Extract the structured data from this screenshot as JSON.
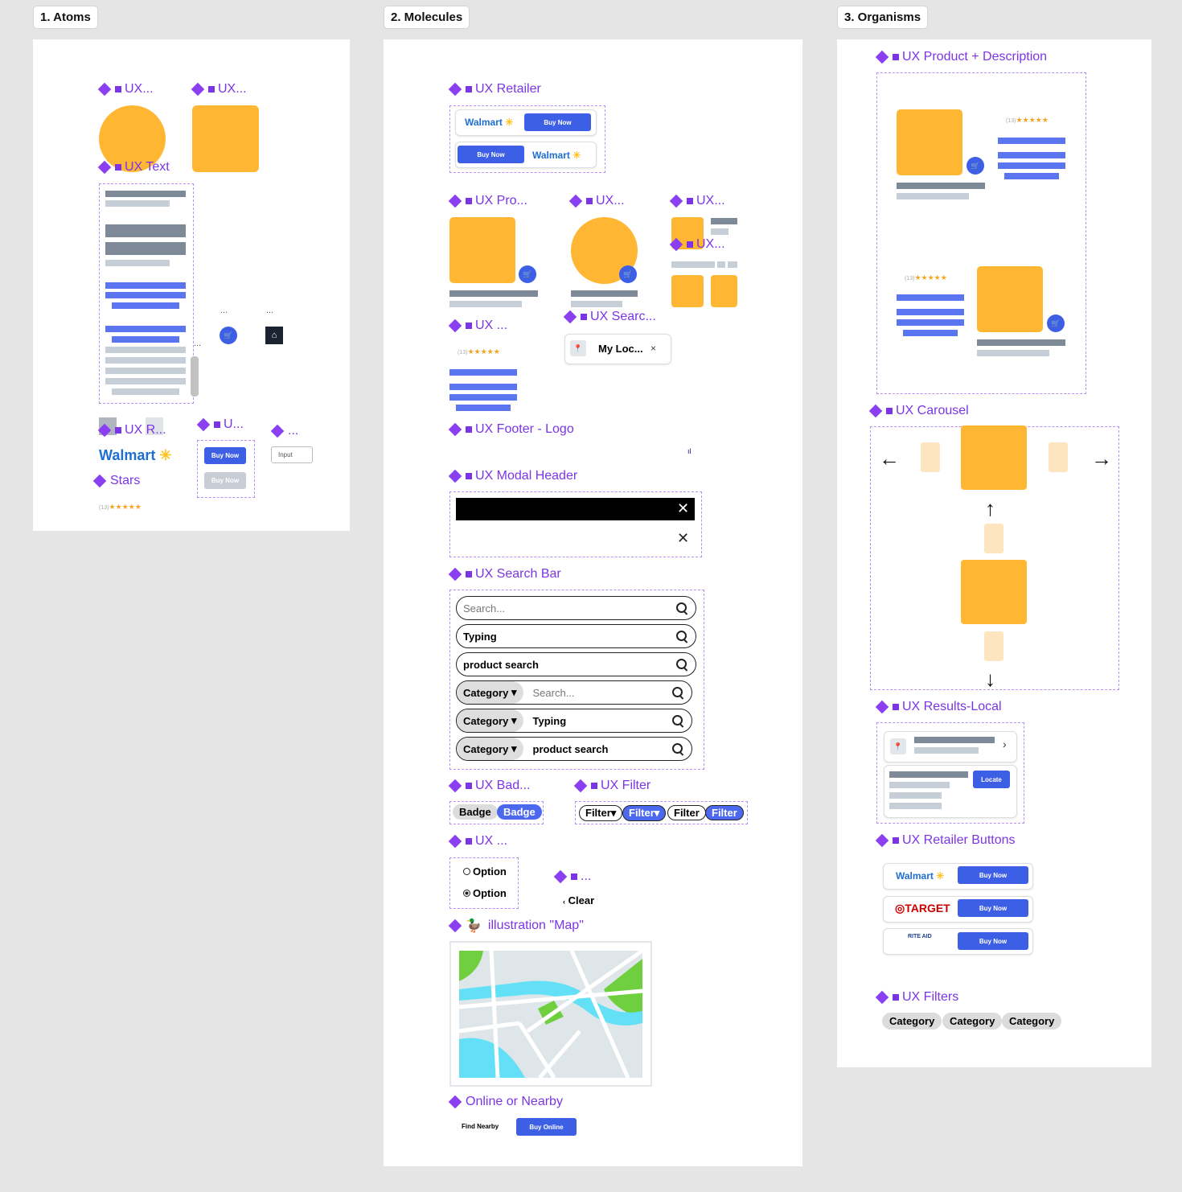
{
  "frames": {
    "atoms": "1. Atoms",
    "molecules": "2. Molecules",
    "organisms": "3. Organisms"
  },
  "atoms": {
    "comp_image_round": "UX...",
    "comp_image_square": "UX...",
    "comp_text": "UX Text",
    "comp_icons_label": "UX R...",
    "comp_buttons": "U...",
    "comp_input": "...",
    "comp_stars": "Stars",
    "ellipsis": "...",
    "walmart": "Walmart",
    "buy_now": "Buy Now",
    "buy_now_disabled": "Buy Now",
    "input_label": "Input",
    "star_count": "(13)",
    "stars": "★★★★★",
    "cart_icon": "cart-icon",
    "basket_icon": "basket-icon"
  },
  "molecules": {
    "comp_retailer": "UX Retailer",
    "walmart": "Walmart",
    "buy_now": "Buy Now",
    "comp_product": "UX Pro...",
    "comp_product_round": "UX...",
    "comp_product_small_a": "UX...",
    "comp_product_small_b": "UX...",
    "comp_rating": "UX ...",
    "star_count": "(13)",
    "stars": "★★★★★",
    "comp_search_chip": "UX Searc...",
    "location_chip": "My Loc...",
    "location_close": "×",
    "comp_footer": "UX Footer - Logo",
    "comp_modal_header": "UX Modal Header",
    "close": "✕",
    "comp_search_bar": "UX Search Bar",
    "search_rows": [
      {
        "category": "",
        "text": "Search...",
        "placeholder": true
      },
      {
        "category": "",
        "text": "Typing",
        "placeholder": false
      },
      {
        "category": "",
        "text": "product search",
        "placeholder": false
      },
      {
        "category": "Category",
        "text": "Search...",
        "placeholder": true
      },
      {
        "category": "Category",
        "text": "Typing",
        "placeholder": false
      },
      {
        "category": "Category",
        "text": "product search",
        "placeholder": false
      }
    ],
    "comp_badge": "UX Bad...",
    "badges": [
      "Badge",
      "Badge"
    ],
    "comp_filter": "UX Filter",
    "filters": [
      "Filter",
      "Filter",
      "Filter",
      "Filter"
    ],
    "comp_options": "UX ...",
    "options": [
      "Option",
      "Option"
    ],
    "comp_clear": "...",
    "clear": "Clear",
    "comp_map": "illustration \"Map\"",
    "comp_online": "Online or Nearby",
    "find_nearby": "Find Nearby",
    "buy_online": "Buy Online"
  },
  "organisms": {
    "comp_product_desc": "UX Product + Description",
    "star_count": "(13)",
    "stars": "★★★★★",
    "comp_carousel": "UX Carousel",
    "comp_results_local": "UX Results-Local",
    "locate": "Locate",
    "comp_retailer_buttons": "UX Retailer Buttons",
    "walmart": "Walmart",
    "target": "TARGET",
    "rite_aid": "RITE AID",
    "buy_now": "Buy Now",
    "comp_filters": "UX Filters",
    "categories": [
      "Category",
      "Category",
      "Category"
    ]
  },
  "colors": {
    "accent_purple": "#7b35e6",
    "button_blue": "#3d5fe6",
    "placeholder_orange": "#ffb733",
    "walmart_blue": "#1f6fd1",
    "target_red": "#cc0000"
  }
}
